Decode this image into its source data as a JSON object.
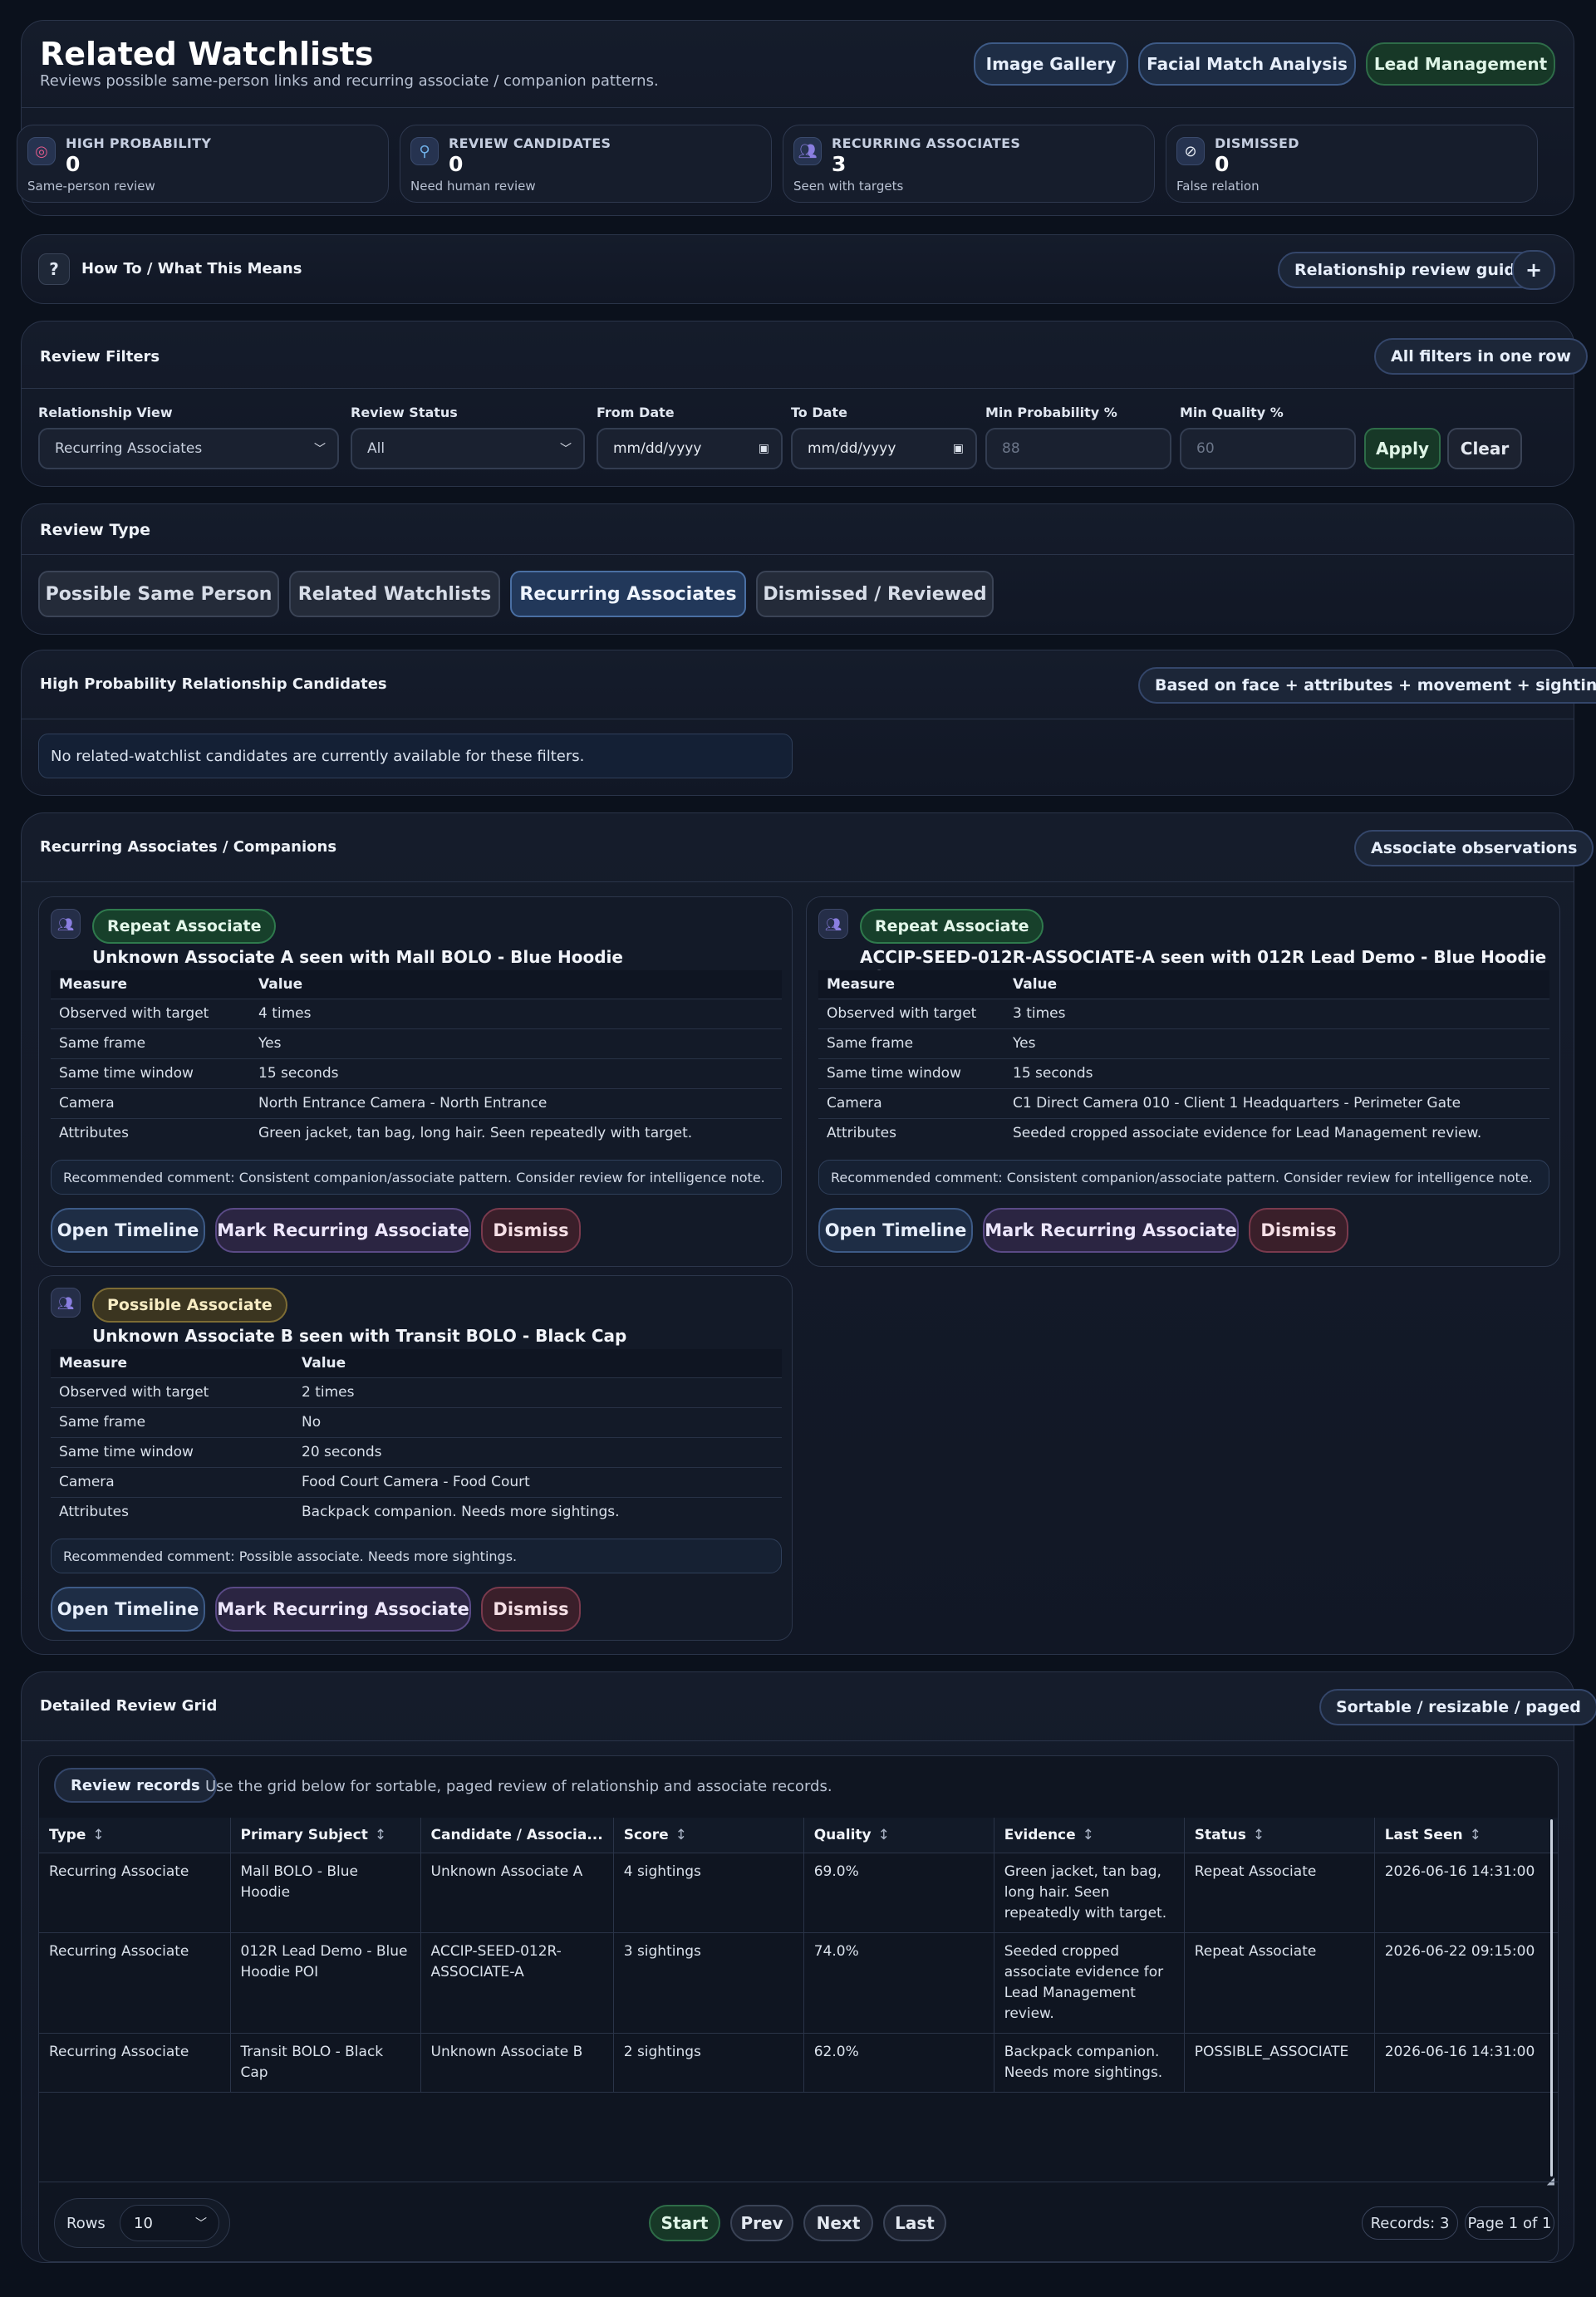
{
  "header": {
    "title": "Related Watchlists",
    "subtitle": "Reviews possible same-person links and recurring associate / companion patterns.",
    "buttons": [
      "Image Gallery",
      "Facial Match Analysis",
      "Lead Management"
    ]
  },
  "stats": [
    {
      "label": "HIGH PROBABILITY",
      "value": "0",
      "sub": "Same-person review",
      "icon": "target-icon"
    },
    {
      "label": "REVIEW CANDIDATES",
      "value": "0",
      "sub": "Need human review",
      "icon": "search-person-icon"
    },
    {
      "label": "RECURRING ASSOCIATES",
      "value": "3",
      "sub": "Seen with targets",
      "icon": "people-icon"
    },
    {
      "label": "DISMISSED",
      "value": "0",
      "sub": "False relation",
      "icon": "prohibited-icon"
    }
  ],
  "howto": {
    "icon": "?",
    "title": "How To / What This Means",
    "guide_label": "Relationship review guide",
    "expand": "+"
  },
  "filters": {
    "title": "Review Filters",
    "tag": "All filters in one row",
    "relationship_view_label": "Relationship View",
    "relationship_view_value": "Recurring Associates",
    "review_status_label": "Review Status",
    "review_status_value": "All",
    "from_date_label": "From Date",
    "from_date_placeholder": "mm/dd/yyyy",
    "to_date_label": "To Date",
    "to_date_placeholder": "mm/dd/yyyy",
    "min_prob_label": "Min Probability %",
    "min_prob_placeholder": "88",
    "min_quality_label": "Min Quality %",
    "min_quality_placeholder": "60",
    "apply": "Apply",
    "clear": "Clear"
  },
  "review_type": {
    "title": "Review Type",
    "tabs": [
      "Possible Same Person",
      "Related Watchlists",
      "Recurring Associates",
      "Dismissed / Reviewed"
    ],
    "active": "Recurring Associates"
  },
  "high_prob": {
    "title": "High Probability Relationship Candidates",
    "tag": "Based on face + attributes + movement + sightings",
    "empty": "No related-watchlist candidates are currently available for these filters."
  },
  "associates": {
    "title": "Recurring Associates / Companions",
    "tag": "Associate observations",
    "table_headers": [
      "Measure",
      "Value"
    ],
    "actions": [
      "Open Timeline",
      "Mark Recurring Associate",
      "Dismiss"
    ],
    "cards": [
      {
        "badge": "Repeat Associate",
        "title": "Unknown Associate A seen with Mall BOLO - Blue Hoodie",
        "rows": [
          [
            "Observed with target",
            "4 times"
          ],
          [
            "Same frame",
            "Yes"
          ],
          [
            "Same time window",
            "15 seconds"
          ],
          [
            "Camera",
            "North Entrance Camera - North Entrance"
          ],
          [
            "Attributes",
            "Green jacket, tan bag, long hair. Seen repeatedly with target."
          ]
        ],
        "comment": "Recommended comment: Consistent companion/associate pattern. Consider review for intelligence note."
      },
      {
        "badge": "Repeat Associate",
        "title": "ACCIP-SEED-012R-ASSOCIATE-A seen with 012R Lead Demo - Blue Hoodie POI",
        "rows": [
          [
            "Observed with target",
            "3 times"
          ],
          [
            "Same frame",
            "Yes"
          ],
          [
            "Same time window",
            "15 seconds"
          ],
          [
            "Camera",
            "C1 Direct Camera 010 - Client 1 Headquarters - Perimeter Gate"
          ],
          [
            "Attributes",
            "Seeded cropped associate evidence for Lead Management review."
          ]
        ],
        "comment": "Recommended comment: Consistent companion/associate pattern. Consider review for intelligence note."
      },
      {
        "badge": "Possible Associate",
        "title": "Unknown Associate B seen with Transit BOLO - Black Cap",
        "rows": [
          [
            "Observed with target",
            "2 times"
          ],
          [
            "Same frame",
            "No"
          ],
          [
            "Same time window",
            "20 seconds"
          ],
          [
            "Camera",
            "Food Court Camera - Food Court"
          ],
          [
            "Attributes",
            "Backpack companion. Needs more sightings."
          ]
        ],
        "comment": "Recommended comment: Possible associate. Needs more sightings."
      }
    ]
  },
  "grid": {
    "title": "Detailed Review Grid",
    "tag": "Sortable / resizable / paged",
    "records_chip": "Review records",
    "records_desc": "Use the grid below for sortable, paged review of relationship and associate records.",
    "columns": [
      "Type",
      "Primary Subject",
      "Candidate / Associa...",
      "Score",
      "Quality",
      "Evidence",
      "Status",
      "Last Seen"
    ],
    "rows": [
      [
        "Recurring Associate",
        "Mall BOLO - Blue Hoodie",
        "Unknown Associate A",
        "4 sightings",
        "69.0%",
        "Green jacket, tan bag, long hair. Seen repeatedly with target.",
        "Repeat Associate",
        "2026-06-16 14:31:00"
      ],
      [
        "Recurring Associate",
        "012R Lead Demo - Blue Hoodie POI",
        "ACCIP-SEED-012R-ASSOCIATE-A",
        "3 sightings",
        "74.0%",
        "Seeded cropped associate evidence for Lead Management review.",
        "Repeat Associate",
        "2026-06-22 09:15:00"
      ],
      [
        "Recurring Associate",
        "Transit BOLO - Black Cap",
        "Unknown Associate B",
        "2 sightings",
        "62.0%",
        "Backpack companion. Needs more sightings.",
        "POSSIBLE_ASSOCIATE",
        "2026-06-16 14:31:00"
      ]
    ],
    "rows_label": "Rows",
    "rows_value": "10",
    "pager": [
      "Start",
      "Prev",
      "Next",
      "Last"
    ],
    "records_count": "Records: 3",
    "page_info": "Page 1 of 1"
  }
}
